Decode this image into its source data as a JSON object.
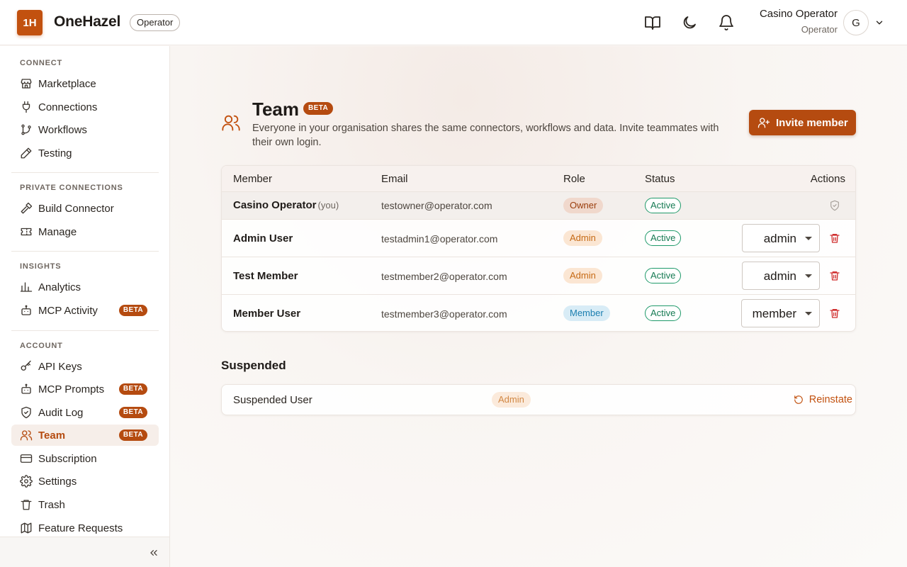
{
  "header": {
    "logo_text": "1H",
    "brand": "OneHazel",
    "brand_tag": "Operator",
    "user_name": "Casino Operator",
    "user_role": "Operator",
    "avatar_initial": "G"
  },
  "sidebar": {
    "sections": [
      {
        "label": "CONNECT"
      },
      {
        "label": "PRIVATE CONNECTIONS"
      },
      {
        "label": "INSIGHTS"
      },
      {
        "label": "ACCOUNT"
      }
    ],
    "items": [
      {
        "label": "Marketplace",
        "icon": "store-icon"
      },
      {
        "label": "Connections",
        "icon": "plug-icon"
      },
      {
        "label": "Workflows",
        "icon": "workflow-icon"
      },
      {
        "label": "Testing",
        "icon": "pencil-icon"
      },
      {
        "label": "Build Connector",
        "icon": "hammer-icon"
      },
      {
        "label": "Manage",
        "icon": "ticket-icon"
      },
      {
        "label": "Analytics",
        "icon": "bar-chart-icon"
      },
      {
        "label": "MCP Activity",
        "icon": "bot-icon",
        "badge": "BETA"
      },
      {
        "label": "API Keys",
        "icon": "key-icon"
      },
      {
        "label": "MCP Prompts",
        "icon": "bot-icon",
        "badge": "BETA"
      },
      {
        "label": "Audit Log",
        "icon": "shield-check-icon",
        "badge": "BETA"
      },
      {
        "label": "Team",
        "icon": "users-icon",
        "badge": "BETA",
        "active": true
      },
      {
        "label": "Subscription",
        "icon": "credit-card-icon"
      },
      {
        "label": "Settings",
        "icon": "gear-icon"
      },
      {
        "label": "Trash",
        "icon": "trash-icon"
      },
      {
        "label": "Feature Requests",
        "icon": "map-icon"
      }
    ]
  },
  "page": {
    "title": "Team",
    "title_badge": "BETA",
    "description": "Everyone in your organisation shares the same connectors, workflows and data. Invite teammates with their own login.",
    "invite_label": "Invite member"
  },
  "table": {
    "headers": {
      "member": "Member",
      "email": "Email",
      "role": "Role",
      "status": "Status",
      "actions": "Actions"
    },
    "rows": [
      {
        "name": "Casino Operator",
        "you": "(you)",
        "email": "testowner@operator.com",
        "role": "Owner",
        "status": "Active"
      },
      {
        "name": "Admin User",
        "email": "testadmin1@operator.com",
        "role": "Admin",
        "status": "Active",
        "select": "admin"
      },
      {
        "name": "Test Member",
        "email": "testmember2@operator.com",
        "role": "Admin",
        "status": "Active",
        "select": "admin"
      },
      {
        "name": "Member User",
        "email": "testmember3@operator.com",
        "role": "Member",
        "status": "Active",
        "select": "member"
      }
    ]
  },
  "suspended": {
    "title": "Suspended",
    "rows": [
      {
        "name": "Suspended User",
        "role": "Admin",
        "action": "Reinstate"
      }
    ]
  },
  "colors": {
    "accent": "#b54b10",
    "active_status": "#157a52",
    "danger": "#d02f2f"
  }
}
